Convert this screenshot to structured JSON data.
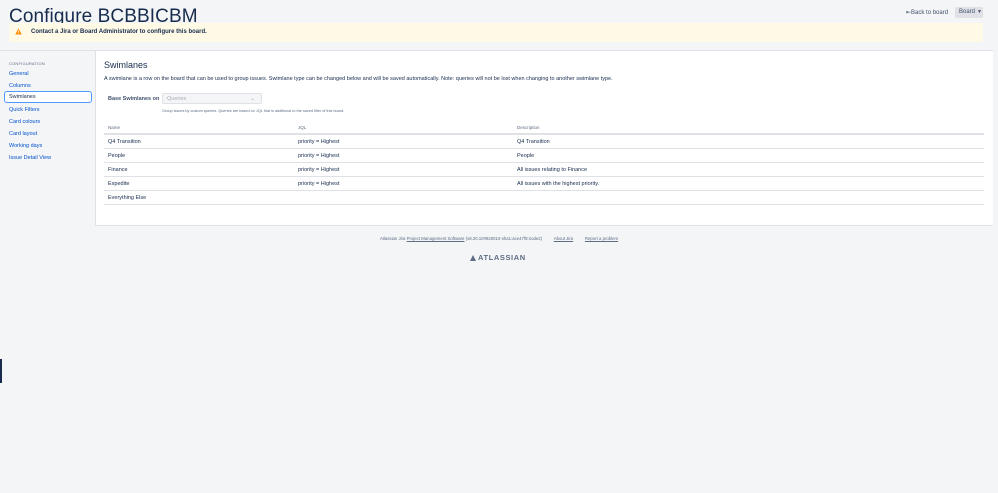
{
  "header": {
    "title": "Configure BCBBICBM",
    "back_link": "Back to board",
    "board_button": "Board"
  },
  "warning": {
    "text": "Contact a Jira or Board Administrator to configure this board.",
    "color": "#fffae6",
    "icon": "warning-icon"
  },
  "sidebar": {
    "heading": "CONFIGURATION",
    "items": [
      {
        "label": "General"
      },
      {
        "label": "Columns"
      },
      {
        "label": "Swimlanes"
      },
      {
        "label": "Quick Filters"
      },
      {
        "label": "Card colours"
      },
      {
        "label": "Card layout"
      },
      {
        "label": "Working days"
      },
      {
        "label": "Issue Detail View"
      }
    ]
  },
  "main": {
    "heading": "Swimlanes",
    "intro": "A swimlane is a row on the board that can be used to group issues. Swimlane type can be changed below and will be saved automatically. Note: queries will not be lost when changing to another swimlane type.",
    "base_label": "Base Swimlanes on",
    "base_value": "Queries",
    "help_text": "Group issues by custom queries. Queries are based on JQL that is additional to the saved filter of this board."
  },
  "table": {
    "headers": {
      "name": "Name",
      "jql": "JQL",
      "description": "Description"
    },
    "rows": [
      {
        "name": "Q4 Transition",
        "jql": "priority = Highest",
        "description": "Q4 Transition"
      },
      {
        "name": "People",
        "jql": "priority = Highest",
        "description": "People"
      },
      {
        "name": "Finance",
        "jql": "priority = Highest",
        "description": "All issues relating to Finance"
      },
      {
        "name": "Expedite",
        "jql": "priority = Highest",
        "description": "All issues with the highest priority."
      },
      {
        "name": "Everything Else",
        "jql": "",
        "description": ""
      }
    ]
  },
  "footer": {
    "prefix": "Atlassian Jira",
    "pm_link": "Project Management Software",
    "version": "(v8.20.10#820010-sha1:ace47f9:node2)",
    "about": "About Jira",
    "report": "Report a problem",
    "logo": "ATLASSIAN"
  },
  "colors": {
    "link": "#0052cc",
    "text": "#172b4d",
    "accent_border": "#4c9aff",
    "background": "#f4f5f7"
  }
}
